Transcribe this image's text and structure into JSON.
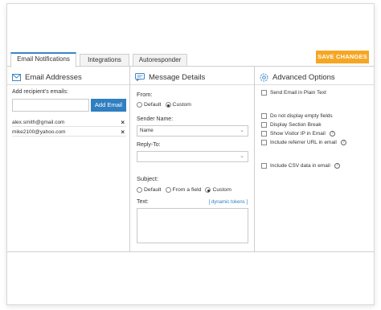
{
  "toolbar": {
    "save_label": "SAVE CHANGES"
  },
  "tabs": [
    {
      "label": "Email Notifications",
      "active": true
    },
    {
      "label": "Integrations",
      "active": false
    },
    {
      "label": "Autoresponder",
      "active": false
    }
  ],
  "email_addresses": {
    "title": "Email Addresses",
    "add_label": "Add recipient's emails:",
    "input_value": "",
    "add_button": "Add Email",
    "emails": [
      "alex.smith@gmail.com",
      "mike2100@yahoo.com"
    ],
    "remove_glyph": "×"
  },
  "message_details": {
    "title": "Message Details",
    "from_label": "From:",
    "from_options": [
      {
        "label": "Default",
        "selected": false
      },
      {
        "label": "Custom",
        "selected": true
      }
    ],
    "sender_label": "Sender Name:",
    "sender_value": "Name",
    "reply_label": "Reply-To:",
    "reply_value": "",
    "subject_label": "Subject:",
    "subject_options": [
      {
        "label": "Default",
        "selected": false
      },
      {
        "label": "From a field",
        "selected": false
      },
      {
        "label": "Custom",
        "selected": true
      }
    ],
    "text_label": "Text:",
    "dynamic_tokens": "[ dynamic tokens ]",
    "text_value": ""
  },
  "advanced_options": {
    "title": "Advanced Options",
    "options": [
      {
        "label": "Send Email in Plain Text",
        "checked": false,
        "help": false
      },
      {
        "label": "Do not display empty fields",
        "checked": false,
        "help": false
      },
      {
        "label": "Display Section Break",
        "checked": false,
        "help": false
      },
      {
        "label": "Show Visitor IP in Email",
        "checked": false,
        "help": true
      },
      {
        "label": "Include referrer URL in email",
        "checked": false,
        "help": true
      },
      {
        "label": "Include CSV data in email",
        "checked": false,
        "help": true
      }
    ],
    "help_glyph": "?"
  },
  "colors": {
    "accent_blue": "#2f7fc1",
    "save_orange": "#f5a623",
    "tab_active_top": "#3a86c8"
  },
  "icons": [
    "envelope-icon",
    "speech-bubble-icon",
    "gear-icon",
    "close-icon",
    "chevron-down-icon",
    "help-icon"
  ]
}
